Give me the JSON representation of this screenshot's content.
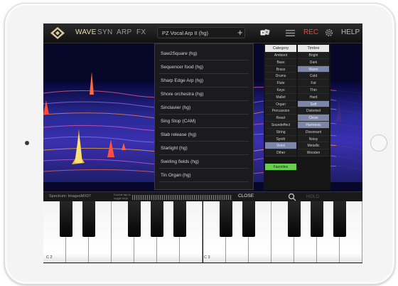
{
  "app": {
    "nav": {
      "wave": "WAVE",
      "syn": "SYN",
      "arp": "ARP",
      "fx": "FX"
    },
    "preset_name": "PZ Vocal Arp II (hg)",
    "add_label": "+",
    "rec_label": "REC",
    "help_label": "HELP",
    "icons": {
      "logo": "diamond-logo-icon",
      "dice": "dice-icon",
      "menu": "menu-icon",
      "gear": "gear-icon"
    },
    "colors": {
      "accent_active": "#e6e0a8",
      "rec": "#e04c3a",
      "tag_selected": "#7b86a8",
      "favorites": "#68cf4e"
    }
  },
  "preset_list": [
    "Saw2Square (hg)",
    "Sequencer food (hg)",
    "Sharp Edge Arp (hg)",
    "Shore orchestra (hg)",
    "Sinclavier (hg)",
    "Sing Stop (CAM)",
    "Slab release (hg)",
    "Starlight (hg)",
    "Swirling fields (hg)",
    "Tin Organ (hg)"
  ],
  "categories": {
    "header": "Category",
    "items": [
      "Ambient",
      "Bass",
      "Brass",
      "Drums",
      "Flute",
      "Keys",
      "Mallet",
      "Organ",
      "Percussion",
      "React",
      "Soundeffect",
      "String",
      "Synth",
      "Voice",
      "Other"
    ],
    "selected": [
      "Voice"
    ],
    "favorites_label": "Favorites"
  },
  "timbres": {
    "header": "Timbre",
    "items": [
      "Bright",
      "Dark",
      "Warm",
      "Cold",
      "Fat",
      "Thin",
      "Hard",
      "Soft",
      "Distorted",
      "Clean",
      "Harmonic",
      "Dissonant",
      "Noisy",
      "Metallic",
      "Wooden"
    ],
    "selected": [
      "Warm",
      "Soft",
      "Clean",
      "Harmonic"
    ]
  },
  "bottom": {
    "spectrum_label": "Spectrum: ImagesMX07",
    "double_tap_label": "Double tap to toggle keys",
    "close_label": "CLOSE",
    "hold_label": "HOLD"
  },
  "keyboard": {
    "labels": [
      "C 2",
      "C 3"
    ]
  }
}
